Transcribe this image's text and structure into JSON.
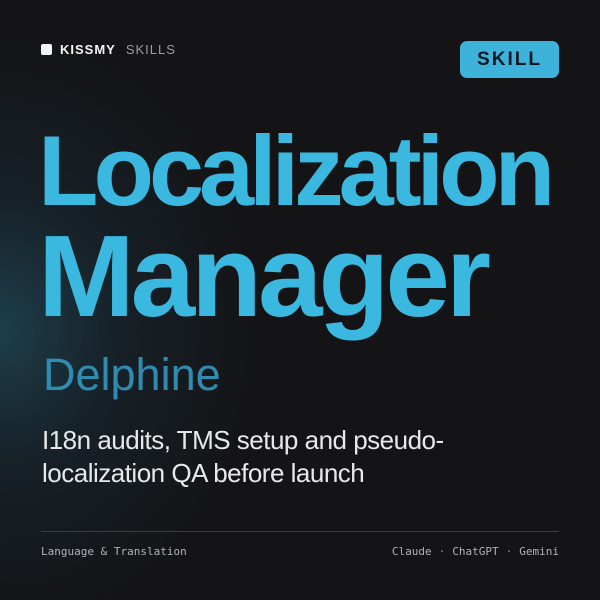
{
  "brand": {
    "name": "KISSMY",
    "sub": "SKILLS",
    "logo_icon": "square-logo-icon"
  },
  "badge": {
    "label": "SKILL",
    "color": "#3db3dc"
  },
  "title": {
    "line1": "Localization",
    "line2": "Manager",
    "color": "#3ab8e0"
  },
  "persona": {
    "name": "Delphine",
    "color": "#2f8bb0"
  },
  "description": "I18n audits, TMS setup and pseudo-localization QA before launch",
  "footer": {
    "category": "Language & Translation",
    "platforms": [
      "Claude",
      "ChatGPT",
      "Gemini"
    ],
    "separator": "·"
  },
  "colors": {
    "background": "#141416",
    "glow": "#266078"
  }
}
